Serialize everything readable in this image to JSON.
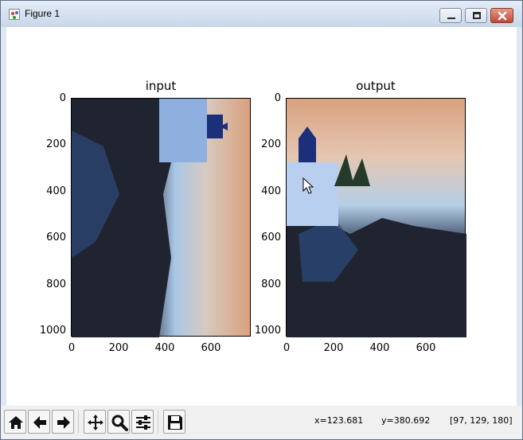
{
  "window": {
    "title": "Figure 1"
  },
  "plots": [
    {
      "title": "input",
      "yticks": [
        "0",
        "200",
        "400",
        "600",
        "800",
        "1000"
      ],
      "xticks": [
        "0",
        "200",
        "400",
        "600"
      ]
    },
    {
      "title": "output",
      "yticks": [
        "0",
        "200",
        "400",
        "600",
        "800",
        "1000"
      ],
      "xticks": [
        "0",
        "200",
        "400",
        "600"
      ]
    }
  ],
  "status": {
    "x": "x=123.681",
    "y": "y=380.692",
    "pixel": "[97, 129, 180]"
  },
  "icons": [
    "home-icon",
    "back-icon",
    "forward-icon",
    "pan-icon",
    "zoom-icon",
    "subplots-icon",
    "save-icon"
  ]
}
